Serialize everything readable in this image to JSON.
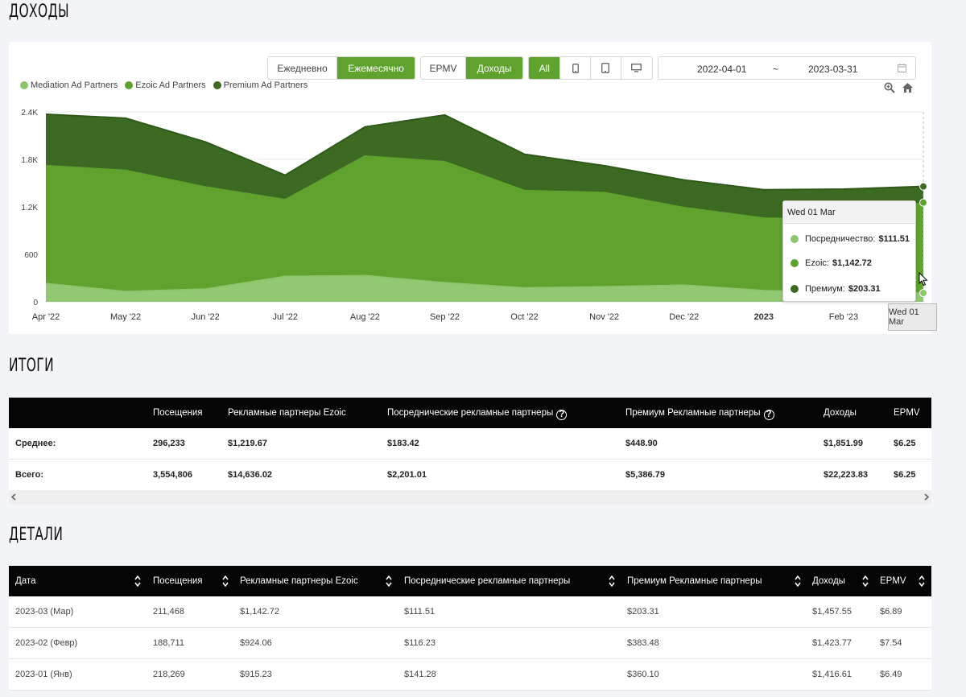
{
  "sections": {
    "income_title": "ДОХОДЫ",
    "totals_title": "ИТОГИ",
    "details_title": "ДЕТАЛИ"
  },
  "controls": {
    "period": [
      "Ежедневно",
      "Ежемесячно"
    ],
    "period_active": 1,
    "metric": [
      "EPMV",
      "Доходы"
    ],
    "metric_active": 1,
    "device_all": "All",
    "date_from": "2022-04-01",
    "date_sep": "~",
    "date_to": "2023-03-31"
  },
  "legend": [
    {
      "name": "Mediation Ad Partners",
      "color": "#8dc56c"
    },
    {
      "name": "Ezoic Ad Partners",
      "color": "#5fa22e"
    },
    {
      "name": "Premium Ad Partners",
      "color": "#3c6a23"
    }
  ],
  "chart_data": {
    "type": "area",
    "stacked": true,
    "categories": [
      "Apr '22",
      "May '22",
      "Jun '22",
      "Jul '22",
      "Aug '22",
      "Sep '22",
      "Oct '22",
      "Nov '22",
      "Dec '22",
      "2023",
      "Feb '23",
      "Wed 01 Mar"
    ],
    "x_tick_labels": [
      "Apr '22",
      "May '22",
      "Jun '22",
      "Jul '22",
      "Aug '22",
      "Sep '22",
      "Oct '22",
      "Nov '22",
      "Dec '22",
      "2023",
      "Feb '23"
    ],
    "y_ticks": [
      "0",
      "600",
      "1.2K",
      "1.8K",
      "2.4K"
    ],
    "ylim": [
      0,
      2400
    ],
    "series": [
      {
        "name": "Mediation Ad Partners",
        "color": "#8dc56c",
        "values": [
          230,
          130,
          160,
          320,
          330,
          240,
          175,
          190,
          210,
          141.28,
          116.23,
          111.51
        ]
      },
      {
        "name": "Ezoic Ad Partners",
        "color": "#5fa22e",
        "values": [
          1490,
          1530,
          1290,
          970,
          1510,
          1530,
          1230,
          1190,
          980,
          915.23,
          924.06,
          1142.72
        ]
      },
      {
        "name": "Premium Ad Partners",
        "color": "#3c6a23",
        "values": [
          650,
          660,
          570,
          310,
          370,
          590,
          460,
          340,
          350,
          360.1,
          383.48,
          203.31
        ]
      }
    ]
  },
  "tooltip": {
    "title": "Wed 01 Mar",
    "rows": [
      {
        "label": "Посредничество:",
        "value": "$111.51",
        "color": "#8dc56c"
      },
      {
        "label": "Ezoic:",
        "value": "$1,142.72",
        "color": "#5fa22e"
      },
      {
        "label": "Премиум:",
        "value": "$203.31",
        "color": "#3c6a23"
      }
    ],
    "x_label": "Wed 01 Mar"
  },
  "totals": {
    "headers": [
      "Посещения",
      "Рекламные партнеры Ezoic",
      "Посреднические рекламные партнеры",
      "Премиум Рекламные партнеры",
      "Доходы",
      "EPMV"
    ],
    "rows": [
      {
        "label": "Среднее:",
        "cells": [
          "296,233",
          "$1,219.67",
          "$183.42",
          "$448.90",
          "$1,851.99",
          "$6.25"
        ]
      },
      {
        "label": "Всего:",
        "cells": [
          "3,554,806",
          "$14,636.02",
          "$2,201.01",
          "$5,386.79",
          "$22,223.83",
          "$6.25"
        ]
      }
    ]
  },
  "details": {
    "headers": [
      "Дата",
      "Посещения",
      "Рекламные партнеры Ezoic",
      "Посреднические рекламные партнеры",
      "Премиум Рекламные партнеры",
      "Доходы",
      "EPMV"
    ],
    "rows": [
      [
        "2023-03 (Мар)",
        "211,468",
        "$1,142.72",
        "$111.51",
        "$203.31",
        "$1,457.55",
        "$6.89"
      ],
      [
        "2023-02 (Февр)",
        "188,711",
        "$924.06",
        "$116.23",
        "$383.48",
        "$1,423.77",
        "$7.54"
      ],
      [
        "2023-01 (Янв)",
        "218,269",
        "$915.23",
        "$141.28",
        "$360.10",
        "$1,416.61",
        "$6.49"
      ]
    ]
  }
}
